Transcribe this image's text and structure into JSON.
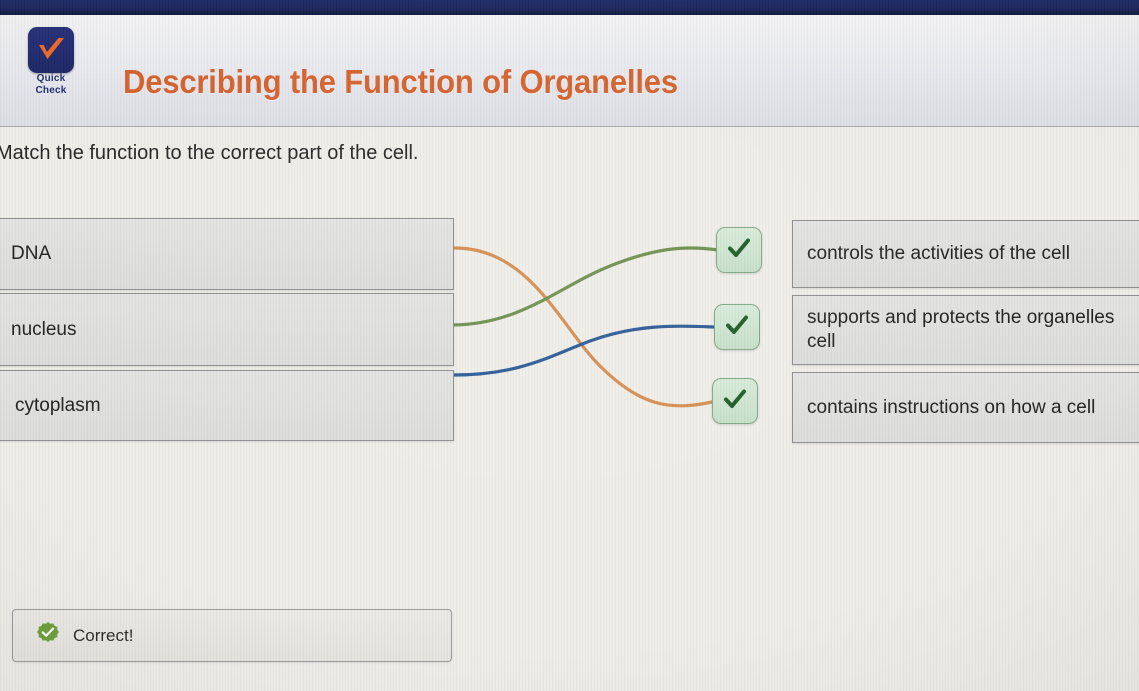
{
  "header": {
    "logo": {
      "icon": "check-mark-icon",
      "line1": "Quick",
      "line2": "Check",
      "tile_color": "#1d2766",
      "check_color": "#ef6a2a"
    },
    "title": "Describing the Function of Organelles",
    "title_color": "#d4622e",
    "bar_color": "#1b2559"
  },
  "instruction": "Match the function to the correct part of the cell.",
  "match": {
    "left_items": [
      {
        "label": "DNA"
      },
      {
        "label": "nucleus"
      },
      {
        "label": "cytoplasm"
      }
    ],
    "right_items": [
      {
        "label": "controls the activities of the cell"
      },
      {
        "label": "supports and protects the organelles\ncell"
      },
      {
        "label": "contains instructions on how a cell"
      }
    ],
    "badges": [
      {
        "icon": "check-mark-icon"
      },
      {
        "icon": "check-mark-icon"
      },
      {
        "icon": "check-mark-icon"
      }
    ],
    "connections": [
      {
        "from": "DNA",
        "to": "contains instructions on how a cell",
        "color": "#d58d4f"
      },
      {
        "from": "nucleus",
        "to": "controls the activities of the cell",
        "color": "#6e8f4e"
      },
      {
        "from": "cytoplasm",
        "to": "supports and protects the organelles cell",
        "color": "#2d5a96"
      }
    ]
  },
  "feedback": {
    "icon": "check-circle-icon",
    "text": "Correct!",
    "color": "#6d9f3a"
  }
}
